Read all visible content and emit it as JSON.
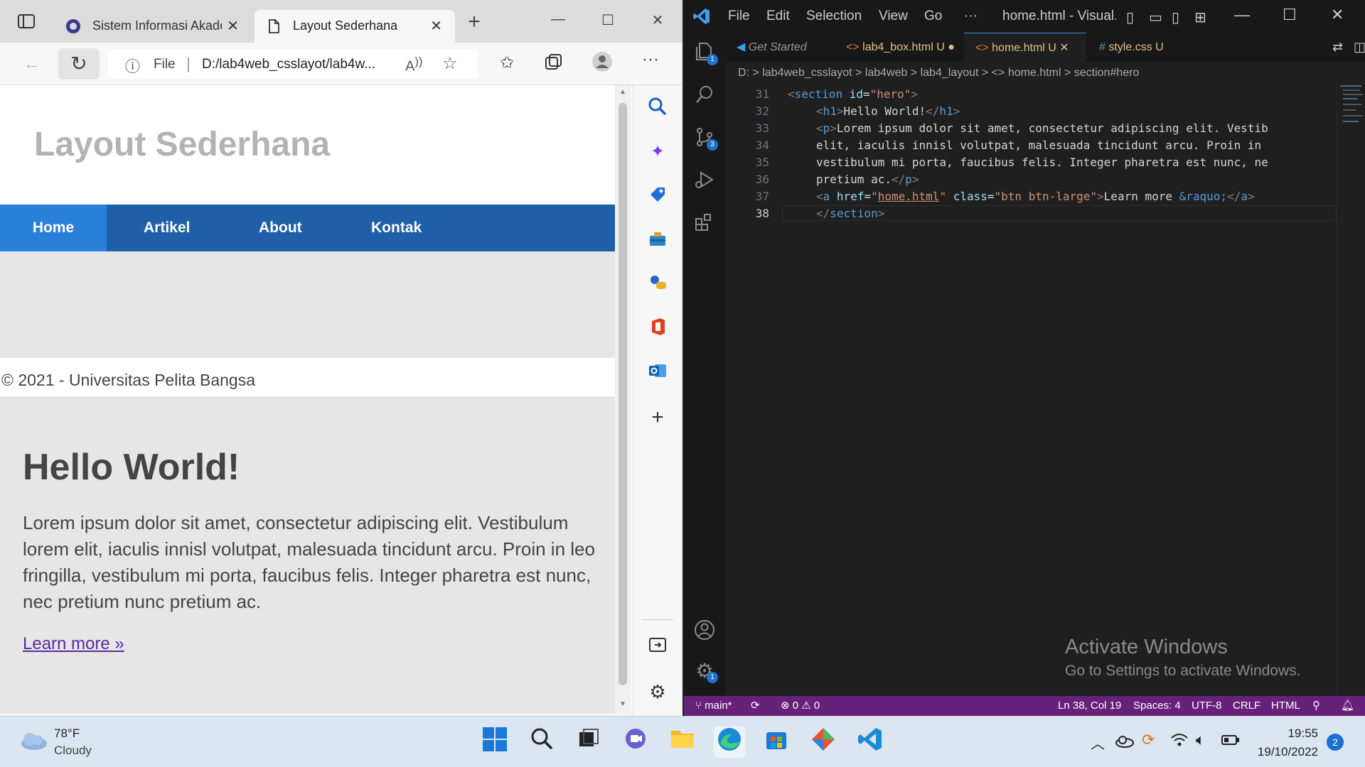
{
  "browser": {
    "tabs": [
      {
        "label": "Sistem Informasi Akademik",
        "close": "✕"
      },
      {
        "label": "Layout Sederhana",
        "close": "✕"
      }
    ],
    "new_tab": "+",
    "window_controls": {
      "minimize": "—",
      "maximize": "☐",
      "close": "✕"
    },
    "address": {
      "info": "ⓘ",
      "scheme": "File",
      "url": "D:/lab4web_csslayot/lab4w..."
    }
  },
  "page": {
    "site_title": "Layout Sederhana",
    "nav": [
      "Home",
      "Artikel",
      "About",
      "Kontak"
    ],
    "footer": "© 2021 - Universitas Pelita Bangsa",
    "hero": {
      "heading": "Hello World!",
      "paragraph": "Lorem ipsum dolor sit amet, consectetur adipiscing elit. Vestibulum lorem elit, iaculis innisl volutpat, malesuada tincidunt arcu. Proin in leo fringilla, vestibulum mi porta, faucibus felis. Integer pharetra est nunc, nec pretium nunc pretium ac.",
      "link": "Learn more »"
    }
  },
  "vscode": {
    "menu": [
      "File",
      "Edit",
      "Selection",
      "View",
      "Go",
      "···"
    ],
    "window_title": "home.html - Visual...",
    "tabs": [
      {
        "label": "Get Started",
        "state": ""
      },
      {
        "label": "lab4_box.html",
        "state": "U ●"
      },
      {
        "label": "home.html",
        "state": "U ✕"
      },
      {
        "label": "style.css",
        "state": "U"
      }
    ],
    "breadcrumb": "D: > lab4web_csslayot > lab4web > lab4_layout > <> home.html > section#hero",
    "line_numbers": [
      "31",
      "32",
      "33",
      "34",
      "35",
      "36",
      "37",
      "38"
    ],
    "code_text": {
      "l33": "Lorem ipsum dolor sit amet, consectetur adipiscing elit. Vestib",
      "l34": "elit, iaculis innisl volutpat, malesuada tincidunt arcu. Proin in",
      "l35": "vestibulum mi porta, faucibus felis. Integer pharetra est nunc, ne",
      "l36": "pretium ac.",
      "l32": "Hello World!",
      "l37": "Learn more "
    },
    "watermark": {
      "title": "Activate Windows",
      "subtitle": "Go to Settings to activate Windows."
    },
    "status": {
      "branch": "main*",
      "sync": "⟳",
      "problems": "⊗ 0 ⚠ 0",
      "position": "Ln 38, Col 19",
      "spaces": "Spaces: 4",
      "encoding": "UTF-8",
      "eol": "CRLF",
      "language": "HTML"
    },
    "badges": {
      "explorer": "1",
      "scm": "3",
      "settings": "1"
    }
  },
  "taskbar": {
    "weather": {
      "temp": "78°F",
      "condition": "Cloudy"
    },
    "time": "19:55",
    "date": "19/10/2022",
    "notifications": "2"
  },
  "colors": {
    "nav": "#2060a8",
    "nav_active": "#2a7fd8",
    "statusbar": "#68217a",
    "accent": "#1f73c9"
  }
}
